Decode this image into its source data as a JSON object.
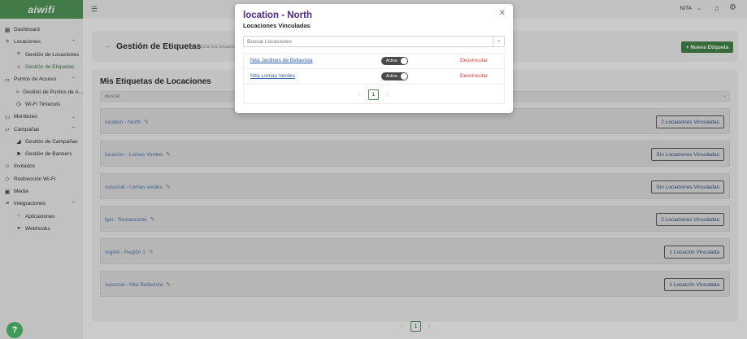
{
  "app": {
    "logo": "aiwifi"
  },
  "topbar": {
    "user_name": "NITA"
  },
  "sidebar": {
    "items": [
      {
        "label": "Dashboard"
      },
      {
        "label": "Locaciones"
      },
      {
        "label": "Gestión de Locaciones"
      },
      {
        "label": "Gestión de Etiquetas"
      },
      {
        "label": "Puntos de Acceso"
      },
      {
        "label": "Gestión de Puntos de A..."
      },
      {
        "label": "Wi-Fi Timeouts"
      },
      {
        "label": "Monitoreo"
      },
      {
        "label": "Campañas"
      },
      {
        "label": "Gestión de Campañas"
      },
      {
        "label": "Gestión de Banners"
      },
      {
        "label": "Invitados"
      },
      {
        "label": "Redirección Wi-Fi"
      },
      {
        "label": "Media"
      },
      {
        "label": "Integraciones"
      },
      {
        "label": "Aplicaciones"
      },
      {
        "label": "Webhooks"
      }
    ]
  },
  "header": {
    "title": "Gestión de Etiquetas",
    "subtitle": "Organiza tus locacio",
    "new_button": "+ Nueva Etiqueta"
  },
  "list": {
    "title": "Mis Etiquetas de Locaciones",
    "search_placeholder": "Buscar",
    "tags": [
      {
        "name": "location - North",
        "button": "2 Locaciones Vinculadas"
      },
      {
        "name": "locación - Lomas Verdes",
        "button": "Sin Locaciones Vinculadas"
      },
      {
        "name": "sucursal - Lomas verdes",
        "button": "Sin Locaciones Vinculadas"
      },
      {
        "name": "tipo - Restaurante",
        "button": "2 Locaciones Vinculadas"
      },
      {
        "name": "región - Región 1",
        "button": "1 Locación Vinculada"
      },
      {
        "name": "sucursal - Nita Bellavista",
        "button": "1 Locación Vinculada"
      }
    ],
    "page": "1"
  },
  "modal": {
    "title": "location - North",
    "subtitle": "Locaciones Vinculadas",
    "search_placeholder": "Buscar Locaciones",
    "rows": [
      {
        "name": "Nita Jardines de Bellavista",
        "status": "Activa",
        "action": "Desvincular"
      },
      {
        "name": "Nita Lomas Verdes",
        "status": "Activa",
        "action": "Desvincular"
      }
    ],
    "page": "1"
  },
  "colors": {
    "brand": "#4c8b52",
    "link": "#2f5fa8",
    "danger": "#d43a2a",
    "modal_title": "#4a2a8a"
  }
}
